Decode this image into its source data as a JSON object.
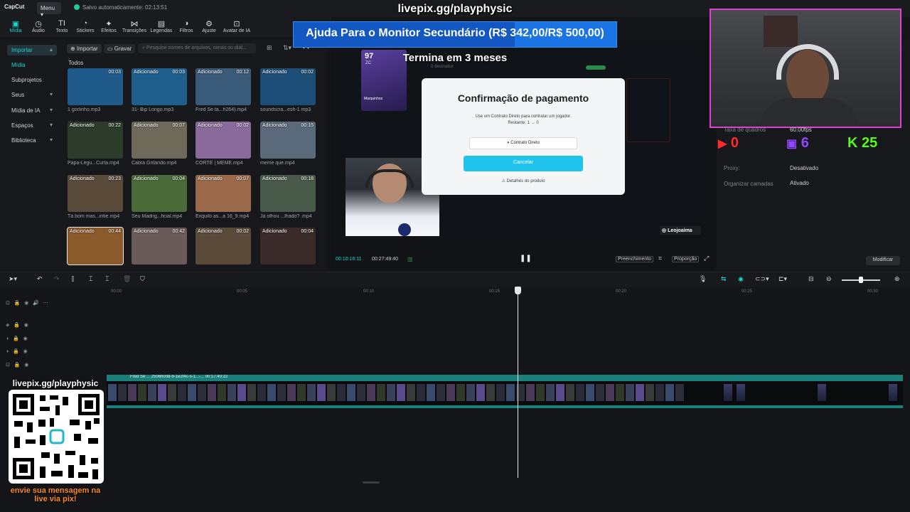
{
  "app": {
    "logo": "CapCut",
    "menu_label": "Menu",
    "autosave": "Salvo automaticamente: 02:13:51"
  },
  "stream_overlay": {
    "url_top": "livepix.gg/playphysic",
    "goal": "Ajuda Para o Monitor Secundário (R$ 342,00/R$ 500,00)",
    "goal_progress": 0.684,
    "ends": "Termina em 3 meses",
    "qr_url": "livepix.gg/playphysic",
    "qr_message_line1": "envie sua mensagem na",
    "qr_message_line2": "live via pix!",
    "streamer_tag": "Leojoaima",
    "youtube_count": "0",
    "twitch_count": "6",
    "kick_count": "25"
  },
  "tools": [
    {
      "label": "Mídia",
      "icon": "media-icon",
      "glyph": "▣"
    },
    {
      "label": "Áudio",
      "icon": "audio-icon",
      "glyph": "◷"
    },
    {
      "label": "Texto",
      "icon": "text-icon",
      "glyph": "TI"
    },
    {
      "label": "Stickers",
      "icon": "sticker-icon",
      "glyph": "◔"
    },
    {
      "label": "Efeitos",
      "icon": "effects-icon",
      "glyph": "✦"
    },
    {
      "label": "Transições",
      "icon": "transition-icon",
      "glyph": "⋈"
    },
    {
      "label": "Legendas",
      "icon": "captions-icon",
      "glyph": "▤"
    },
    {
      "label": "Filtros",
      "icon": "filter-icon",
      "glyph": "◑"
    },
    {
      "label": "Ajuste",
      "icon": "adjust-icon",
      "glyph": "⚙"
    },
    {
      "label": "Avatar de IA",
      "icon": "ai-avatar-icon",
      "glyph": "⊡"
    }
  ],
  "leftnav": {
    "importar": "Importar",
    "midia": "Mídia",
    "subprojetos": "Subprojetos",
    "seus": "Seus",
    "midia_ia": "Mídia de IA",
    "espacos": "Espaços",
    "biblioteca": "Biblioteca"
  },
  "media": {
    "import_btn": "Importar",
    "record_btn": "Gravar",
    "search_placeholder": "Pesquise nomes de arquivos, cenas ou diál...",
    "filter_all": "Todos",
    "items": [
      {
        "name": "1 gorlinho.mp3",
        "dur": "00:03",
        "tag": "",
        "bg": "#1f5a8a"
      },
      {
        "name": "31- Bip Longo.mp3",
        "dur": "00:03",
        "tag": "Adicionado",
        "bg": "#1e5f8e"
      },
      {
        "name": "Fred Se ta...h264).mp4",
        "dur": "00:12",
        "tag": "Adicionado",
        "bg": "#3a5a7a"
      },
      {
        "name": "soundscra...esh-1.mp3",
        "dur": "00:02",
        "tag": "Adicionado",
        "bg": "#1d4e78"
      },
      {
        "name": "Papa-Légu...Curta.mp4",
        "dur": "00:22",
        "tag": "Adicionado",
        "bg": "#2c3b2a"
      },
      {
        "name": "Cabra Gritando.mp4",
        "dur": "00:07",
        "tag": "Adicionado",
        "bg": "#6d6a5a"
      },
      {
        "name": "CORTE | MEME.mp4",
        "dur": "00:02",
        "tag": "Adicionado",
        "bg": "#8a6a9a"
      },
      {
        "name": "meme que.mp4",
        "dur": "00:15",
        "tag": "Adicionado",
        "bg": "#5a6a7a"
      },
      {
        "name": "Tá bom mas...intie.mp4",
        "dur": "00:23",
        "tag": "Adicionado",
        "bg": "#5a4a3a"
      },
      {
        "name": "Seu Madrig...ficial.mp4",
        "dur": "00:04",
        "tag": "Adicionado",
        "bg": "#4a6a3a"
      },
      {
        "name": "Exquilo as...a 16_9.mp4",
        "dur": "00:07",
        "tag": "Adicionado",
        "bg": "#9a6a4a"
      },
      {
        "name": "Já olhou ...lhado? .mp4",
        "dur": "00:18",
        "tag": "Adicionado",
        "bg": "#4a5a4a"
      },
      {
        "name": "",
        "dur": "00:44",
        "tag": "Adicionado",
        "bg": "#8a5a2a"
      },
      {
        "name": "",
        "dur": "00:42",
        "tag": "Adicionado",
        "bg": "#6a5a5a"
      },
      {
        "name": "",
        "dur": "00:02",
        "tag": "Adicionado",
        "bg": "#5a4a3a"
      },
      {
        "name": "",
        "dur": "00:04",
        "tag": "Adicionado",
        "bg": "#3a2a2a"
      }
    ]
  },
  "player": {
    "dialog_title": "Confirmação de pagamento",
    "dialog_sub1": "Use um Contrato Direto para contratar um jogador.",
    "dialog_sub2": "Restante: 1 → 0",
    "direct_label": "Contrato Direto",
    "cancel_label": "Cancelar",
    "details_label": "Detalhes do produto",
    "timecode_current": "00:10:16:11",
    "timecode_total": "00:27:49:40",
    "fill_label": "Preenchimento",
    "ratio_label": "Proporção",
    "card_rating": "97",
    "card_pos": "ZC",
    "card_name": "Marquinhos"
  },
  "properties": {
    "frames_label": "Taxa de quadros",
    "frames_value": "60.00fps",
    "proxy_label": "Proxy:",
    "proxy_value": "Desativado",
    "layers_label": "Organizar camadas",
    "layers_value": "Ativado",
    "modify_label": "Modificar"
  },
  "timeline": {
    "ruler": [
      "00:00",
      "00:05",
      "00:10",
      "00:15",
      "00:20",
      "00:25",
      "00:30"
    ],
    "clip_header": "Fred Se ... 2506h008-9-1e2f4c-s-1...-... 00:17:40:22",
    "clip_start_label": "Fred Se",
    "clip_duration": "00:17:40:22"
  }
}
